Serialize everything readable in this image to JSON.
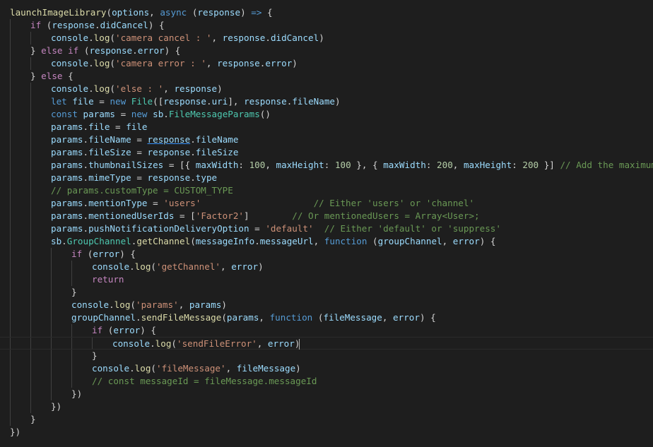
{
  "editor": {
    "lines": [
      {
        "indent": 0,
        "tokens": [
          [
            "launchImageLibrary",
            "fn"
          ],
          [
            "(",
            "plain"
          ],
          [
            "options",
            "var"
          ],
          [
            ", ",
            "plain"
          ],
          [
            "async",
            "kw"
          ],
          [
            " (",
            "plain"
          ],
          [
            "response",
            "var"
          ],
          [
            ") ",
            "plain"
          ],
          [
            "=>",
            "kw"
          ],
          [
            " {",
            "plain"
          ]
        ]
      },
      {
        "indent": 1,
        "tokens": [
          [
            "if",
            "ctrl"
          ],
          [
            " (",
            "plain"
          ],
          [
            "response",
            "var"
          ],
          [
            ".",
            "plain"
          ],
          [
            "didCancel",
            "var"
          ],
          [
            ") {",
            "plain"
          ]
        ]
      },
      {
        "indent": 2,
        "tokens": [
          [
            "console",
            "var"
          ],
          [
            ".",
            "plain"
          ],
          [
            "log",
            "fn"
          ],
          [
            "(",
            "plain"
          ],
          [
            "'camera cancel : '",
            "str"
          ],
          [
            ", ",
            "plain"
          ],
          [
            "response",
            "var"
          ],
          [
            ".",
            "plain"
          ],
          [
            "didCancel",
            "var"
          ],
          [
            ")",
            "plain"
          ]
        ]
      },
      {
        "indent": 1,
        "tokens": [
          [
            "} ",
            "plain"
          ],
          [
            "else",
            "ctrl"
          ],
          [
            " ",
            "plain"
          ],
          [
            "if",
            "ctrl"
          ],
          [
            " (",
            "plain"
          ],
          [
            "response",
            "var"
          ],
          [
            ".",
            "plain"
          ],
          [
            "error",
            "var"
          ],
          [
            ") {",
            "plain"
          ]
        ]
      },
      {
        "indent": 2,
        "tokens": [
          [
            "console",
            "var"
          ],
          [
            ".",
            "plain"
          ],
          [
            "log",
            "fn"
          ],
          [
            "(",
            "plain"
          ],
          [
            "'camera error : '",
            "str"
          ],
          [
            ", ",
            "plain"
          ],
          [
            "response",
            "var"
          ],
          [
            ".",
            "plain"
          ],
          [
            "error",
            "var"
          ],
          [
            ")",
            "plain"
          ]
        ]
      },
      {
        "indent": 1,
        "tokens": [
          [
            "} ",
            "plain"
          ],
          [
            "else",
            "ctrl"
          ],
          [
            " {",
            "plain"
          ]
        ]
      },
      {
        "indent": 2,
        "tokens": [
          [
            "console",
            "var"
          ],
          [
            ".",
            "plain"
          ],
          [
            "log",
            "fn"
          ],
          [
            "(",
            "plain"
          ],
          [
            "'else : '",
            "str"
          ],
          [
            ", ",
            "plain"
          ],
          [
            "response",
            "var"
          ],
          [
            ")",
            "plain"
          ]
        ]
      },
      {
        "indent": 2,
        "tokens": [
          [
            "let",
            "kw"
          ],
          [
            " ",
            "plain"
          ],
          [
            "file",
            "var"
          ],
          [
            " = ",
            "plain"
          ],
          [
            "new",
            "kw"
          ],
          [
            " ",
            "plain"
          ],
          [
            "File",
            "cls"
          ],
          [
            "([",
            "plain"
          ],
          [
            "response",
            "var"
          ],
          [
            ".",
            "plain"
          ],
          [
            "uri",
            "var"
          ],
          [
            "], ",
            "plain"
          ],
          [
            "response",
            "var"
          ],
          [
            ".",
            "plain"
          ],
          [
            "fileName",
            "var"
          ],
          [
            ")",
            "plain"
          ]
        ]
      },
      {
        "indent": 2,
        "tokens": [
          [
            "const",
            "kw"
          ],
          [
            " ",
            "plain"
          ],
          [
            "params",
            "var"
          ],
          [
            " = ",
            "plain"
          ],
          [
            "new",
            "kw"
          ],
          [
            " ",
            "plain"
          ],
          [
            "sb",
            "var"
          ],
          [
            ".",
            "plain"
          ],
          [
            "FileMessageParams",
            "cls"
          ],
          [
            "()",
            "plain"
          ]
        ]
      },
      {
        "indent": 2,
        "tokens": [
          [
            "params",
            "var"
          ],
          [
            ".",
            "plain"
          ],
          [
            "file",
            "var"
          ],
          [
            " = ",
            "plain"
          ],
          [
            "file",
            "var"
          ]
        ]
      },
      {
        "indent": 2,
        "tokens": [
          [
            "params",
            "var"
          ],
          [
            ".",
            "plain"
          ],
          [
            "fileName",
            "var"
          ],
          [
            " = ",
            "plain"
          ],
          [
            "response",
            "ul"
          ],
          [
            ".",
            "plain"
          ],
          [
            "fileName",
            "var"
          ]
        ]
      },
      {
        "indent": 2,
        "tokens": [
          [
            "params",
            "var"
          ],
          [
            ".",
            "plain"
          ],
          [
            "fileSize",
            "var"
          ],
          [
            " = ",
            "plain"
          ],
          [
            "response",
            "var"
          ],
          [
            ".",
            "plain"
          ],
          [
            "fileSize",
            "var"
          ]
        ]
      },
      {
        "indent": 2,
        "tokens": [
          [
            "params",
            "var"
          ],
          [
            ".",
            "plain"
          ],
          [
            "thumbnailSizes",
            "var"
          ],
          [
            " = [{ ",
            "plain"
          ],
          [
            "maxWidth",
            "var"
          ],
          [
            ": ",
            "plain"
          ],
          [
            "100",
            "num"
          ],
          [
            ", ",
            "plain"
          ],
          [
            "maxHeight",
            "var"
          ],
          [
            ": ",
            "plain"
          ],
          [
            "100",
            "num"
          ],
          [
            " }, { ",
            "plain"
          ],
          [
            "maxWidth",
            "var"
          ],
          [
            ": ",
            "plain"
          ],
          [
            "200",
            "num"
          ],
          [
            ", ",
            "plain"
          ],
          [
            "maxHeight",
            "var"
          ],
          [
            ": ",
            "plain"
          ],
          [
            "200",
            "num"
          ],
          [
            " }] ",
            "plain"
          ],
          [
            "// Add the maximum size",
            "cmt"
          ]
        ]
      },
      {
        "indent": 2,
        "tokens": [
          [
            "params",
            "var"
          ],
          [
            ".",
            "plain"
          ],
          [
            "mimeType",
            "var"
          ],
          [
            " = ",
            "plain"
          ],
          [
            "response",
            "var"
          ],
          [
            ".",
            "plain"
          ],
          [
            "type",
            "var"
          ]
        ]
      },
      {
        "indent": 2,
        "tokens": [
          [
            "// params.customType = CUSTOM_TYPE",
            "cmt"
          ]
        ]
      },
      {
        "indent": 2,
        "tokens": [
          [
            "params",
            "var"
          ],
          [
            ".",
            "plain"
          ],
          [
            "mentionType",
            "var"
          ],
          [
            " = ",
            "plain"
          ],
          [
            "'users'",
            "str"
          ],
          [
            "                     ",
            "plain"
          ],
          [
            "// Either 'users' or 'channel'",
            "cmt"
          ]
        ]
      },
      {
        "indent": 2,
        "tokens": [
          [
            "params",
            "var"
          ],
          [
            ".",
            "plain"
          ],
          [
            "mentionedUserIds",
            "var"
          ],
          [
            " = [",
            "plain"
          ],
          [
            "'Factor2'",
            "str"
          ],
          [
            "]        ",
            "plain"
          ],
          [
            "// Or mentionedUsers = Array<User>;",
            "cmt"
          ]
        ]
      },
      {
        "indent": 2,
        "tokens": [
          [
            "params",
            "var"
          ],
          [
            ".",
            "plain"
          ],
          [
            "pushNotificationDeliveryOption",
            "var"
          ],
          [
            " = ",
            "plain"
          ],
          [
            "'default'",
            "str"
          ],
          [
            "  ",
            "plain"
          ],
          [
            "// Either 'default' or 'suppress'",
            "cmt"
          ]
        ]
      },
      {
        "indent": 2,
        "tokens": [
          [
            "sb",
            "var"
          ],
          [
            ".",
            "plain"
          ],
          [
            "GroupChannel",
            "cls"
          ],
          [
            ".",
            "plain"
          ],
          [
            "getChannel",
            "fn"
          ],
          [
            "(",
            "plain"
          ],
          [
            "messageInfo",
            "var"
          ],
          [
            ".",
            "plain"
          ],
          [
            "messageUrl",
            "var"
          ],
          [
            ", ",
            "plain"
          ],
          [
            "function",
            "kw"
          ],
          [
            " (",
            "plain"
          ],
          [
            "groupChannel",
            "var"
          ],
          [
            ", ",
            "plain"
          ],
          [
            "error",
            "var"
          ],
          [
            ") {",
            "plain"
          ]
        ]
      },
      {
        "indent": 3,
        "tokens": [
          [
            "if",
            "ctrl"
          ],
          [
            " (",
            "plain"
          ],
          [
            "error",
            "var"
          ],
          [
            ") {",
            "plain"
          ]
        ]
      },
      {
        "indent": 4,
        "tokens": [
          [
            "console",
            "var"
          ],
          [
            ".",
            "plain"
          ],
          [
            "log",
            "fn"
          ],
          [
            "(",
            "plain"
          ],
          [
            "'getChannel'",
            "str"
          ],
          [
            ", ",
            "plain"
          ],
          [
            "error",
            "var"
          ],
          [
            ")",
            "plain"
          ]
        ]
      },
      {
        "indent": 4,
        "tokens": [
          [
            "return",
            "ctrl"
          ]
        ]
      },
      {
        "indent": 3,
        "tokens": [
          [
            "}",
            "plain"
          ]
        ]
      },
      {
        "indent": 3,
        "tokens": [
          [
            "console",
            "var"
          ],
          [
            ".",
            "plain"
          ],
          [
            "log",
            "fn"
          ],
          [
            "(",
            "plain"
          ],
          [
            "'params'",
            "str"
          ],
          [
            ", ",
            "plain"
          ],
          [
            "params",
            "var"
          ],
          [
            ")",
            "plain"
          ]
        ]
      },
      {
        "indent": 3,
        "tokens": [
          [
            "groupChannel",
            "var"
          ],
          [
            ".",
            "plain"
          ],
          [
            "sendFileMessage",
            "fn"
          ],
          [
            "(",
            "plain"
          ],
          [
            "params",
            "var"
          ],
          [
            ", ",
            "plain"
          ],
          [
            "function",
            "kw"
          ],
          [
            " (",
            "plain"
          ],
          [
            "fileMessage",
            "var"
          ],
          [
            ", ",
            "plain"
          ],
          [
            "error",
            "var"
          ],
          [
            ") {",
            "plain"
          ]
        ]
      },
      {
        "indent": 4,
        "tokens": [
          [
            "if",
            "ctrl"
          ],
          [
            " (",
            "plain"
          ],
          [
            "error",
            "var"
          ],
          [
            ") {",
            "plain"
          ]
        ]
      },
      {
        "indent": 5,
        "tokens": [
          [
            "console",
            "var"
          ],
          [
            ".",
            "plain"
          ],
          [
            "log",
            "fn"
          ],
          [
            "(",
            "plain"
          ],
          [
            "'sendFileError'",
            "str"
          ],
          [
            ", ",
            "plain"
          ],
          [
            "error",
            "var"
          ],
          [
            ")",
            "plain"
          ]
        ],
        "current": true
      },
      {
        "indent": 4,
        "tokens": [
          [
            "}",
            "plain"
          ]
        ]
      },
      {
        "indent": 4,
        "tokens": [
          [
            "console",
            "var"
          ],
          [
            ".",
            "plain"
          ],
          [
            "log",
            "fn"
          ],
          [
            "(",
            "plain"
          ],
          [
            "'fileMessage'",
            "str"
          ],
          [
            ", ",
            "plain"
          ],
          [
            "fileMessage",
            "var"
          ],
          [
            ")",
            "plain"
          ]
        ]
      },
      {
        "indent": 4,
        "tokens": [
          [
            "// const messageId = fileMessage.messageId",
            "cmt"
          ]
        ]
      },
      {
        "indent": 3,
        "tokens": [
          [
            "})",
            "plain"
          ]
        ]
      },
      {
        "indent": 2,
        "tokens": [
          [
            "})",
            "plain"
          ]
        ]
      },
      {
        "indent": 1,
        "tokens": [
          [
            "}",
            "plain"
          ]
        ]
      },
      {
        "indent": 0,
        "tokens": [
          [
            "})",
            "plain"
          ]
        ]
      }
    ],
    "colors": {
      "background": "#1e1e1e",
      "plain": "#d4d4d4",
      "function": "#dcdcaa",
      "variable": "#9cdcfe",
      "keyword": "#569cd6",
      "control": "#c586c0",
      "string": "#ce9178",
      "number": "#b5cea8",
      "comment": "#6a9955",
      "class": "#4ec9b0"
    }
  }
}
